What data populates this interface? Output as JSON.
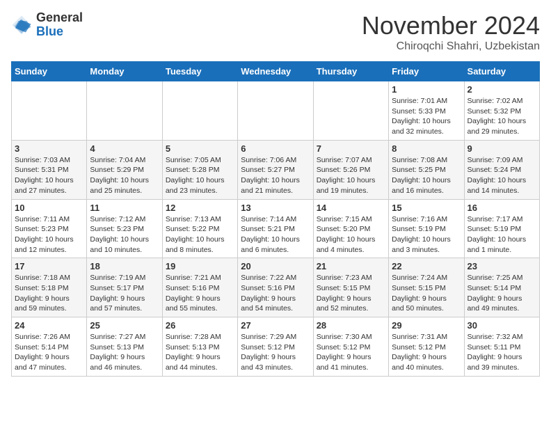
{
  "header": {
    "logo_general": "General",
    "logo_blue": "Blue",
    "month": "November 2024",
    "location": "Chiroqchi Shahri, Uzbekistan"
  },
  "weekdays": [
    "Sunday",
    "Monday",
    "Tuesday",
    "Wednesday",
    "Thursday",
    "Friday",
    "Saturday"
  ],
  "weeks": [
    [
      {
        "day": "",
        "info": ""
      },
      {
        "day": "",
        "info": ""
      },
      {
        "day": "",
        "info": ""
      },
      {
        "day": "",
        "info": ""
      },
      {
        "day": "",
        "info": ""
      },
      {
        "day": "1",
        "info": "Sunrise: 7:01 AM\nSunset: 5:33 PM\nDaylight: 10 hours\nand 32 minutes."
      },
      {
        "day": "2",
        "info": "Sunrise: 7:02 AM\nSunset: 5:32 PM\nDaylight: 10 hours\nand 29 minutes."
      }
    ],
    [
      {
        "day": "3",
        "info": "Sunrise: 7:03 AM\nSunset: 5:31 PM\nDaylight: 10 hours\nand 27 minutes."
      },
      {
        "day": "4",
        "info": "Sunrise: 7:04 AM\nSunset: 5:29 PM\nDaylight: 10 hours\nand 25 minutes."
      },
      {
        "day": "5",
        "info": "Sunrise: 7:05 AM\nSunset: 5:28 PM\nDaylight: 10 hours\nand 23 minutes."
      },
      {
        "day": "6",
        "info": "Sunrise: 7:06 AM\nSunset: 5:27 PM\nDaylight: 10 hours\nand 21 minutes."
      },
      {
        "day": "7",
        "info": "Sunrise: 7:07 AM\nSunset: 5:26 PM\nDaylight: 10 hours\nand 19 minutes."
      },
      {
        "day": "8",
        "info": "Sunrise: 7:08 AM\nSunset: 5:25 PM\nDaylight: 10 hours\nand 16 minutes."
      },
      {
        "day": "9",
        "info": "Sunrise: 7:09 AM\nSunset: 5:24 PM\nDaylight: 10 hours\nand 14 minutes."
      }
    ],
    [
      {
        "day": "10",
        "info": "Sunrise: 7:11 AM\nSunset: 5:23 PM\nDaylight: 10 hours\nand 12 minutes."
      },
      {
        "day": "11",
        "info": "Sunrise: 7:12 AM\nSunset: 5:23 PM\nDaylight: 10 hours\nand 10 minutes."
      },
      {
        "day": "12",
        "info": "Sunrise: 7:13 AM\nSunset: 5:22 PM\nDaylight: 10 hours\nand 8 minutes."
      },
      {
        "day": "13",
        "info": "Sunrise: 7:14 AM\nSunset: 5:21 PM\nDaylight: 10 hours\nand 6 minutes."
      },
      {
        "day": "14",
        "info": "Sunrise: 7:15 AM\nSunset: 5:20 PM\nDaylight: 10 hours\nand 4 minutes."
      },
      {
        "day": "15",
        "info": "Sunrise: 7:16 AM\nSunset: 5:19 PM\nDaylight: 10 hours\nand 3 minutes."
      },
      {
        "day": "16",
        "info": "Sunrise: 7:17 AM\nSunset: 5:19 PM\nDaylight: 10 hours\nand 1 minute."
      }
    ],
    [
      {
        "day": "17",
        "info": "Sunrise: 7:18 AM\nSunset: 5:18 PM\nDaylight: 9 hours\nand 59 minutes."
      },
      {
        "day": "18",
        "info": "Sunrise: 7:19 AM\nSunset: 5:17 PM\nDaylight: 9 hours\nand 57 minutes."
      },
      {
        "day": "19",
        "info": "Sunrise: 7:21 AM\nSunset: 5:16 PM\nDaylight: 9 hours\nand 55 minutes."
      },
      {
        "day": "20",
        "info": "Sunrise: 7:22 AM\nSunset: 5:16 PM\nDaylight: 9 hours\nand 54 minutes."
      },
      {
        "day": "21",
        "info": "Sunrise: 7:23 AM\nSunset: 5:15 PM\nDaylight: 9 hours\nand 52 minutes."
      },
      {
        "day": "22",
        "info": "Sunrise: 7:24 AM\nSunset: 5:15 PM\nDaylight: 9 hours\nand 50 minutes."
      },
      {
        "day": "23",
        "info": "Sunrise: 7:25 AM\nSunset: 5:14 PM\nDaylight: 9 hours\nand 49 minutes."
      }
    ],
    [
      {
        "day": "24",
        "info": "Sunrise: 7:26 AM\nSunset: 5:14 PM\nDaylight: 9 hours\nand 47 minutes."
      },
      {
        "day": "25",
        "info": "Sunrise: 7:27 AM\nSunset: 5:13 PM\nDaylight: 9 hours\nand 46 minutes."
      },
      {
        "day": "26",
        "info": "Sunrise: 7:28 AM\nSunset: 5:13 PM\nDaylight: 9 hours\nand 44 minutes."
      },
      {
        "day": "27",
        "info": "Sunrise: 7:29 AM\nSunset: 5:12 PM\nDaylight: 9 hours\nand 43 minutes."
      },
      {
        "day": "28",
        "info": "Sunrise: 7:30 AM\nSunset: 5:12 PM\nDaylight: 9 hours\nand 41 minutes."
      },
      {
        "day": "29",
        "info": "Sunrise: 7:31 AM\nSunset: 5:12 PM\nDaylight: 9 hours\nand 40 minutes."
      },
      {
        "day": "30",
        "info": "Sunrise: 7:32 AM\nSunset: 5:11 PM\nDaylight: 9 hours\nand 39 minutes."
      }
    ]
  ]
}
